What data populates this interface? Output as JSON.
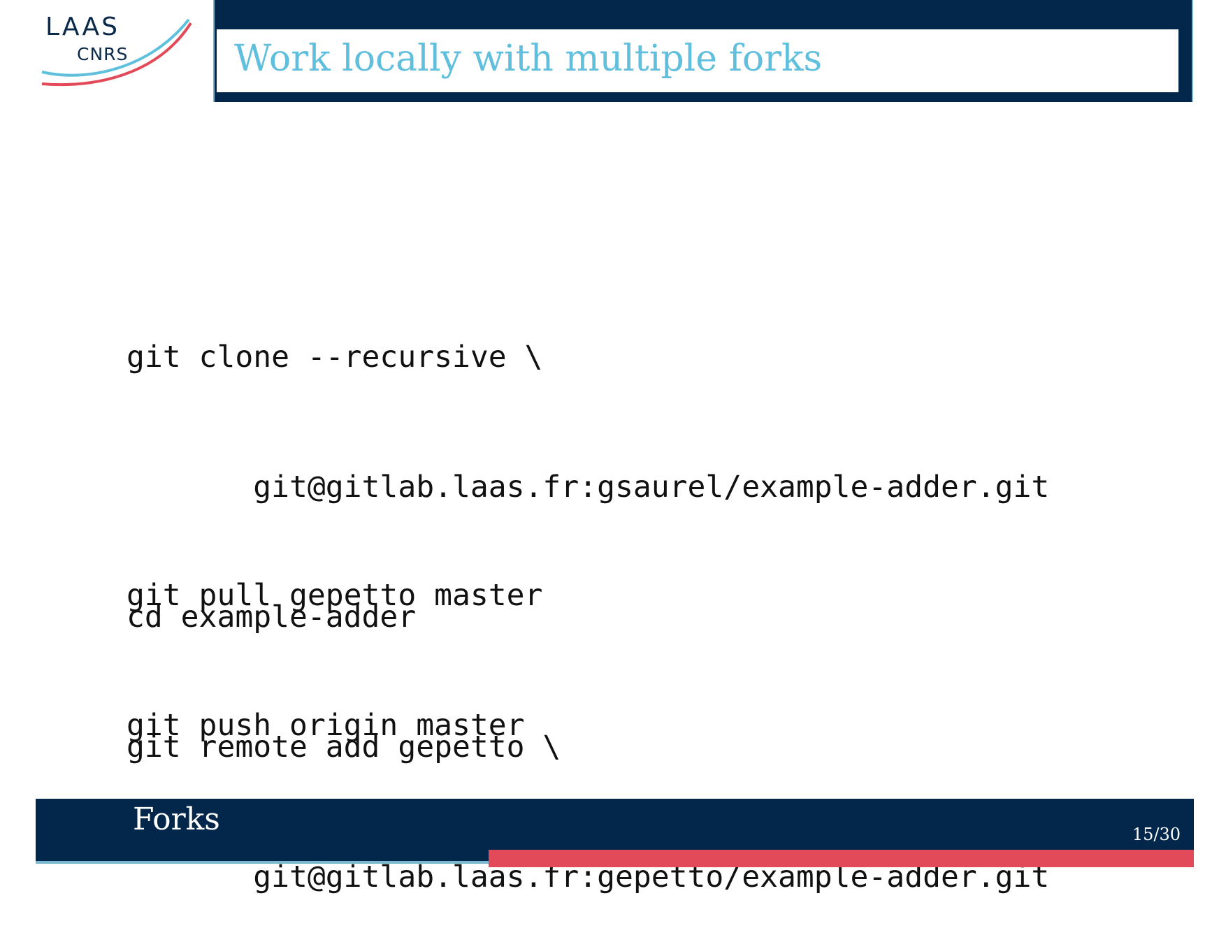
{
  "logo": {
    "line1": "LAAS",
    "line2": "CNRS",
    "swoosh_blue": "#5fc0dd",
    "swoosh_red": "#e34a59"
  },
  "title": "Work locally with multiple forks",
  "code": {
    "block1": [
      "git clone --recursive \\",
      "       git@gitlab.laas.fr:gsaurel/example-adder.git",
      "cd example-adder",
      "git remote add gepetto \\",
      "       git@gitlab.laas.fr:gepetto/example-adder.git"
    ],
    "block2": [
      "git pull gepetto master",
      "git push origin master"
    ]
  },
  "footer": {
    "section": "Forks",
    "page": "15/30"
  },
  "colors": {
    "navy": "#03274a",
    "title": "#5fbfdc",
    "accent_red": "#e34a59",
    "accent_blue": "#7ab7d0"
  }
}
